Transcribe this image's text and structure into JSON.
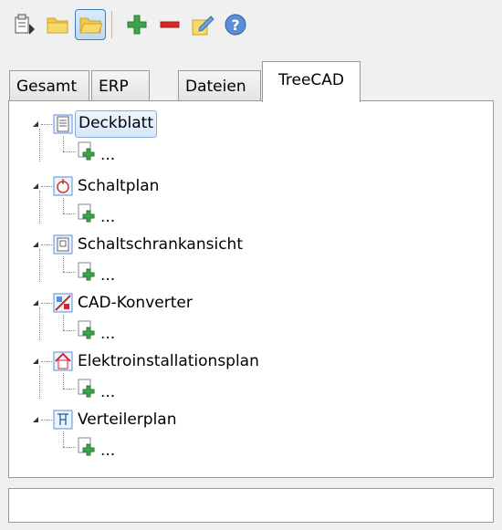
{
  "toolbar": {
    "buttons": [
      {
        "name": "properties-icon"
      },
      {
        "name": "folder-icon"
      },
      {
        "name": "folder-open-icon"
      },
      {
        "name": "add-icon"
      },
      {
        "name": "remove-icon"
      },
      {
        "name": "edit-icon"
      },
      {
        "name": "help-icon"
      }
    ]
  },
  "tabs": [
    {
      "label": "Gesamt"
    },
    {
      "label": "ERP"
    },
    {
      "label": "Dateien"
    },
    {
      "label": "TreeCAD"
    }
  ],
  "tree": {
    "nodes": [
      {
        "label": "Deckblatt",
        "icon": "cover-page-icon",
        "child": "..."
      },
      {
        "label": "Schaltplan",
        "icon": "schematic-icon",
        "child": "..."
      },
      {
        "label": "Schaltschrankansicht",
        "icon": "cabinet-view-icon",
        "child": "..."
      },
      {
        "label": "CAD-Konverter",
        "icon": "cad-converter-icon",
        "child": "..."
      },
      {
        "label": "Elektroinstallationsplan",
        "icon": "installation-plan-icon",
        "child": "..."
      },
      {
        "label": "Verteilerplan",
        "icon": "distribution-plan-icon",
        "child": "..."
      }
    ]
  },
  "status": {
    "text": ""
  },
  "colors": {
    "accent": "#3d7fb5",
    "add": "#3fa34d",
    "remove": "#d9262b",
    "folder": "#f2c94c"
  }
}
